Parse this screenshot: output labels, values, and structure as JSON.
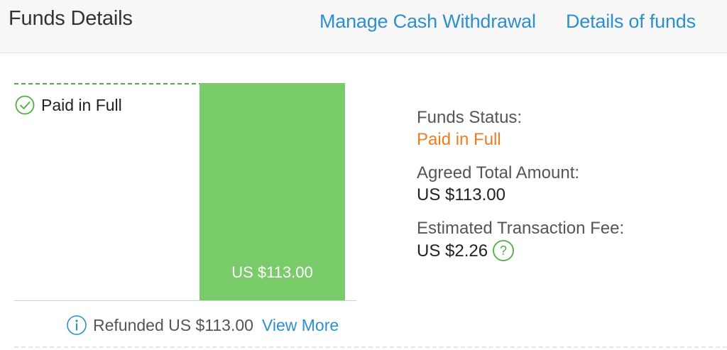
{
  "header": {
    "title": "Funds Details",
    "links": {
      "withdraw": "Manage Cash Withdrawal",
      "details": "Details of funds"
    }
  },
  "chart": {
    "legend_label": "Paid in Full",
    "bar_label": "US $113.00",
    "refund_text": "Refunded US $113.00",
    "view_more": "View More"
  },
  "status": {
    "funds_status_label": "Funds Status:",
    "funds_status_value": "Paid in Full",
    "agreed_total_label": "Agreed Total Amount:",
    "agreed_total_value": "US $113.00",
    "fee_label": "Estimated Transaction Fee:",
    "fee_value": "US $2.26"
  },
  "icons": {
    "legend": "check-circle-icon",
    "refund": "info-icon",
    "fee_help": "help-circle-icon"
  },
  "colors": {
    "link": "#2e8fcf",
    "bar": "#7acc6b",
    "status_paid": "#f07c22",
    "check": "#4fae3f"
  },
  "chart_data": {
    "type": "bar",
    "categories": [
      "Paid in Full"
    ],
    "values": [
      113.0
    ],
    "title": "",
    "xlabel": "",
    "ylabel": "",
    "ylim": [
      0,
      113.0
    ]
  }
}
